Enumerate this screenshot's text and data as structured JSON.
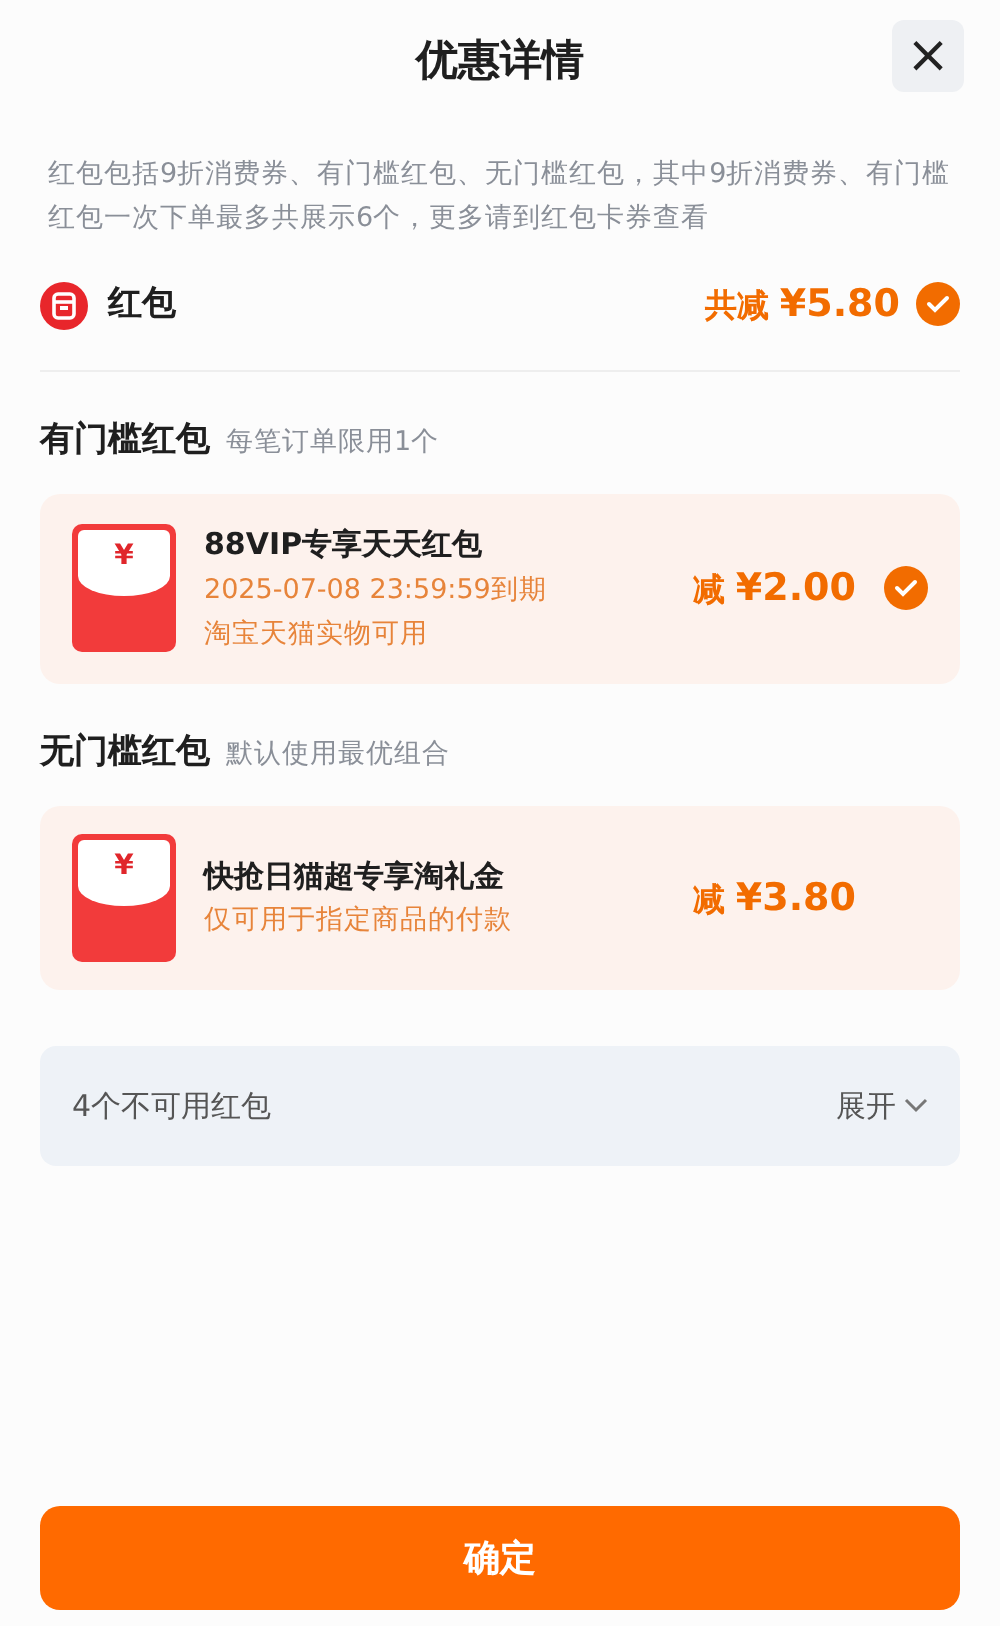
{
  "title": "优惠详情",
  "close": "×",
  "description": "红包包括9折消费券、有门槛红包、无门槛红包，其中9折消费券、有门槛红包一次下单最多共展示6个，更多请到红包卡券查看",
  "summary": {
    "label": "红包",
    "amount_label": "共减",
    "amount": "¥5.80",
    "checked": true
  },
  "sections": [
    {
      "title": "有门槛红包",
      "note": "每笔订单限用1个",
      "coupons": [
        {
          "symbol": "¥",
          "name": "88VIP专享天天红包",
          "lines": [
            "2025-07-08 23:59:59到期",
            "淘宝天猫实物可用"
          ],
          "amount_label": "减",
          "amount": "¥2.00",
          "checked": true
        }
      ]
    },
    {
      "title": "无门槛红包",
      "note": "默认使用最优组合",
      "coupons": [
        {
          "symbol": "¥",
          "name": "快抢日猫超专享淘礼金",
          "lines": [
            "仅可用于指定商品的付款"
          ],
          "amount_label": "减",
          "amount": "¥3.80",
          "checked": false
        }
      ]
    }
  ],
  "unavailable": {
    "label": "4个不可用红包",
    "action": "展开",
    "expanded": false
  },
  "confirm": "确定"
}
